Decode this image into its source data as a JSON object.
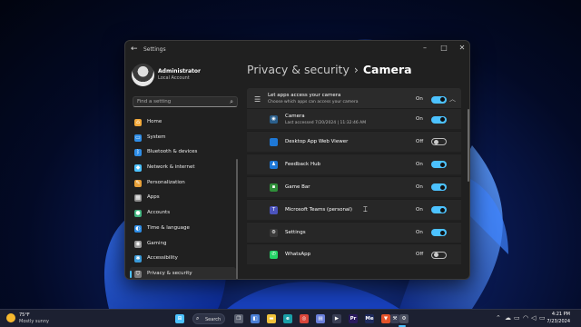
{
  "window": {
    "title": "Settings",
    "back_glyph": "←",
    "minimize_glyph": "–",
    "maximize_glyph": "□",
    "close_glyph": "✕"
  },
  "profile": {
    "name": "Administrator",
    "account_type": "Local Account"
  },
  "search": {
    "placeholder": "Find a setting",
    "icon_glyph": "⌕"
  },
  "sidebar": {
    "items": [
      {
        "label": "Home",
        "icon": "home-icon",
        "glyph": "⌂",
        "color": "#f2a93b",
        "active": false
      },
      {
        "label": "System",
        "icon": "system-icon",
        "glyph": "▭",
        "color": "#2e8de6",
        "active": false
      },
      {
        "label": "Bluetooth & devices",
        "icon": "bluetooth-icon",
        "glyph": "ᛒ",
        "color": "#2e8de6",
        "active": false
      },
      {
        "label": "Network & internet",
        "icon": "network-icon",
        "glyph": "◆",
        "color": "#4cc2ff",
        "active": false
      },
      {
        "label": "Personalization",
        "icon": "brush-icon",
        "glyph": "✎",
        "color": "#e8a13a",
        "active": false
      },
      {
        "label": "Apps",
        "icon": "apps-icon",
        "glyph": "▦",
        "color": "#8c8c8c",
        "active": false
      },
      {
        "label": "Accounts",
        "icon": "accounts-icon",
        "glyph": "●",
        "color": "#3fb37f",
        "active": false
      },
      {
        "label": "Time & language",
        "icon": "globe-icon",
        "glyph": "◐",
        "color": "#2e8de6",
        "active": false
      },
      {
        "label": "Gaming",
        "icon": "gamepad-icon",
        "glyph": "◉",
        "color": "#9a9a9a",
        "active": false
      },
      {
        "label": "Accessibility",
        "icon": "accessibility-icon",
        "glyph": "✱",
        "color": "#3a9ad9",
        "active": false
      },
      {
        "label": "Privacy & security",
        "icon": "shield-icon",
        "glyph": "⛉",
        "color": "#7a7a7a",
        "active": true
      }
    ]
  },
  "breadcrumb": {
    "parent": "Privacy & security",
    "separator": "›",
    "current": "Camera"
  },
  "master": {
    "title": "Let apps access your camera",
    "subtitle": "Choose which apps can access your camera",
    "state": "On",
    "enabled": true,
    "icon_glyph": "☰",
    "chevron_glyph": "︿"
  },
  "apps": [
    {
      "name": "Camera",
      "meta": "Last accessed 7/20/2024  |  11:32:46 AM",
      "state": "On",
      "enabled": true,
      "icon": "camera-app-icon",
      "glyph": "◉",
      "color": "#2b5f8c"
    },
    {
      "name": "Desktop App Web Viewer",
      "meta": "",
      "state": "Off",
      "enabled": false,
      "icon": "web-viewer-icon",
      "glyph": "",
      "color": "#1e78d6"
    },
    {
      "name": "Feedback Hub",
      "meta": "",
      "state": "On",
      "enabled": true,
      "icon": "feedback-hub-icon",
      "glyph": "♟",
      "color": "#1e78d6"
    },
    {
      "name": "Game Bar",
      "meta": "",
      "state": "On",
      "enabled": true,
      "icon": "game-bar-icon",
      "glyph": "▪",
      "color": "#2f8f3a"
    },
    {
      "name": "Microsoft Teams (personal)",
      "meta": "",
      "state": "On",
      "enabled": true,
      "icon": "teams-icon",
      "glyph": "T",
      "color": "#4b53bc"
    },
    {
      "name": "Settings",
      "meta": "",
      "state": "On",
      "enabled": true,
      "icon": "settings-app-icon",
      "glyph": "⚙",
      "color": "#3a3a3a"
    },
    {
      "name": "WhatsApp",
      "meta": "",
      "state": "Off",
      "enabled": false,
      "icon": "whatsapp-icon",
      "glyph": "✆",
      "color": "#25d366"
    }
  ],
  "taskbar": {
    "weather_temp": "75°F",
    "weather_desc": "Mostly sunny",
    "search_label": "Search",
    "search_glyph": "⌕",
    "time": "4:21 PM",
    "date": "7/23/2024",
    "pins": [
      {
        "icon": "start-icon",
        "glyph": "⊞",
        "color": "#4cc2ff"
      },
      {
        "icon": "task-view-icon",
        "glyph": "❐",
        "color": "#5a6070"
      },
      {
        "icon": "meet-icon",
        "glyph": "◧",
        "color": "#4a7fd6"
      },
      {
        "icon": "file-explorer-icon",
        "glyph": "▬",
        "color": "#f0c23b"
      },
      {
        "icon": "edge-icon",
        "glyph": "e",
        "color": "#1aa0a8"
      },
      {
        "icon": "chrome-icon",
        "glyph": "◎",
        "color": "#d9453a"
      },
      {
        "icon": "store-icon",
        "glyph": "▤",
        "color": "#6a7fdb"
      },
      {
        "icon": "media-icon",
        "glyph": "▶",
        "color": "#3a3f55"
      },
      {
        "icon": "premiere-icon",
        "glyph": "Pr",
        "color": "#2a1a5e"
      },
      {
        "icon": "media-encoder-icon",
        "glyph": "Me",
        "color": "#1e2a5e"
      },
      {
        "icon": "brave-icon",
        "glyph": "▼",
        "color": "#e4532a"
      },
      {
        "icon": "tool-icon",
        "glyph": "⚒",
        "color": "#3a3f55"
      },
      {
        "icon": "settings-taskbar-icon",
        "glyph": "⚙",
        "color": "#4a4f60"
      }
    ],
    "tray": [
      {
        "icon": "chevron-up-icon",
        "glyph": "⌃"
      },
      {
        "icon": "onedrive-icon",
        "glyph": "☁"
      },
      {
        "icon": "display-icon",
        "glyph": "▭"
      },
      {
        "icon": "wifi-icon",
        "glyph": "◠"
      },
      {
        "icon": "volume-icon",
        "glyph": "◁"
      },
      {
        "icon": "battery-icon",
        "glyph": "▭"
      }
    ]
  }
}
